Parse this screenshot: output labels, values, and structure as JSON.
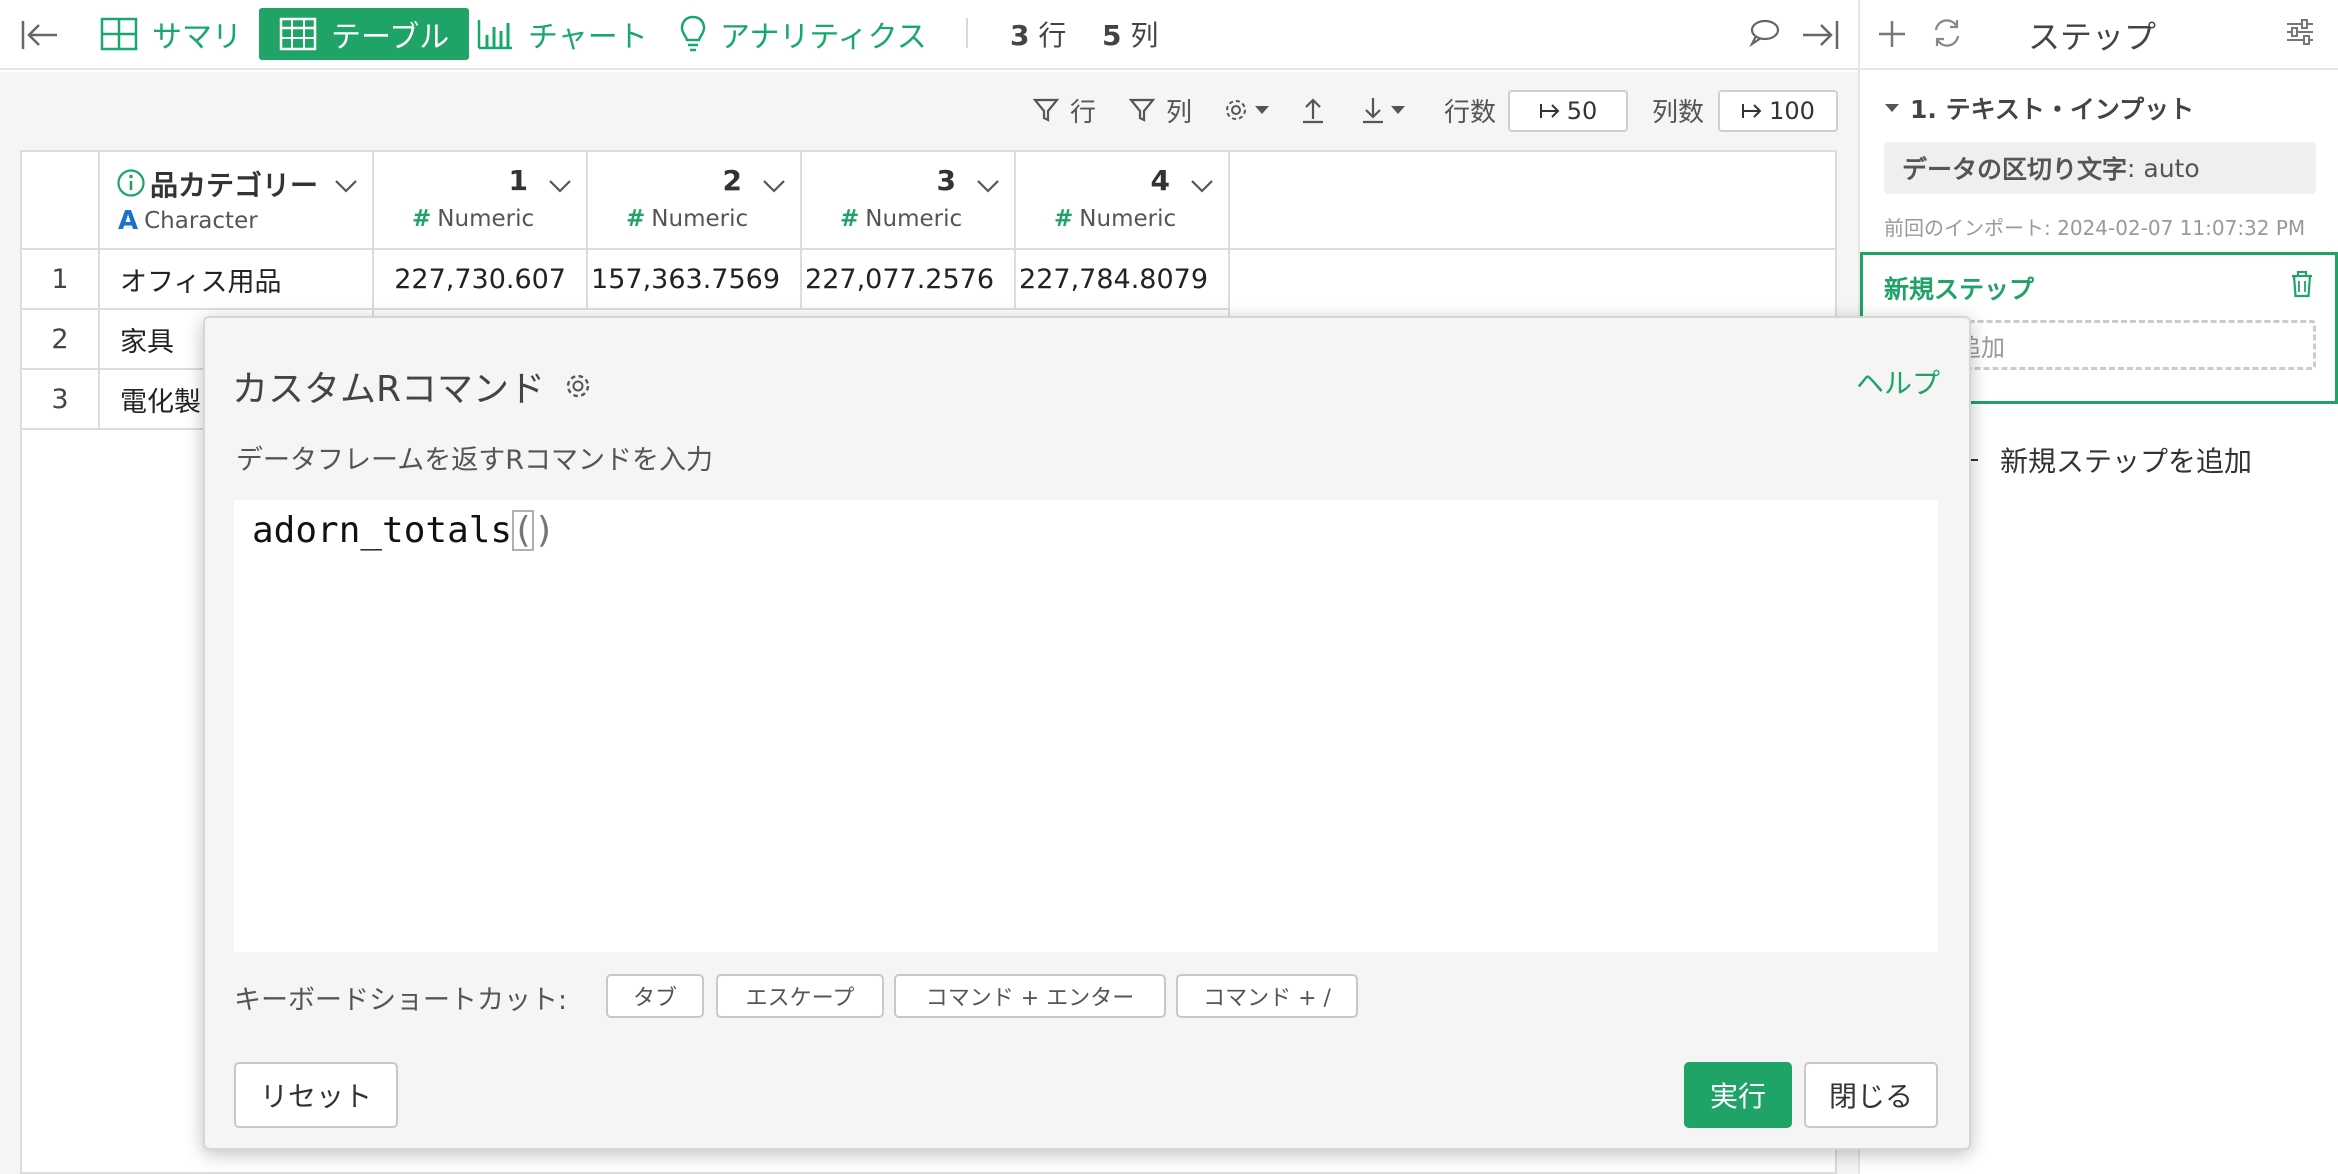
{
  "toolbar": {
    "tabs": [
      {
        "label": "サマリ",
        "icon": "summary-grid-icon"
      },
      {
        "label": "テーブル",
        "icon": "table-icon",
        "active": true
      },
      {
        "label": "チャート",
        "icon": "bar-chart-icon"
      },
      {
        "label": "アナリティクス",
        "icon": "lightbulb-icon"
      }
    ],
    "rows_count": "3",
    "rows_unit": "行",
    "cols_count": "5",
    "cols_unit": "列"
  },
  "subbar": {
    "row_filter": "行",
    "col_filter": "列",
    "rows_label": "行数",
    "rows_value": "50",
    "cols_label": "列数",
    "cols_value": "100"
  },
  "table": {
    "columns": [
      {
        "name": "品カテゴリー",
        "type": "Character"
      },
      {
        "name": "1",
        "type": "Numeric"
      },
      {
        "name": "2",
        "type": "Numeric"
      },
      {
        "name": "3",
        "type": "Numeric"
      },
      {
        "name": "4",
        "type": "Numeric"
      }
    ],
    "rows": [
      {
        "n": "1",
        "cells": [
          "オフィス用品",
          "227,730.607",
          "157,363.7569",
          "227,077.2576",
          "227,784.8079"
        ]
      },
      {
        "n": "2",
        "cells": [
          "家具"
        ]
      },
      {
        "n": "3",
        "cells": [
          "電化製"
        ]
      }
    ]
  },
  "panel": {
    "title": "ステップ",
    "step1_title": "1. テキスト・インプット",
    "step1_key": "データの区切り文字",
    "step1_value": ": auto",
    "step1_timestamp": "前回のインポート: 2024-02-07 11:07:32 PM",
    "new_step_title": "新規ステップ",
    "new_step_add": "追加",
    "add_step_label": "新規ステップを追加"
  },
  "modal": {
    "title": "カスタムRコマンド",
    "help": "ヘルプ",
    "description": "データフレームを返すRコマンドを入力",
    "code_fn": "adorn_totals",
    "code_open": "(",
    "code_close": ")",
    "shortcut_label": "キーボードショートカット:",
    "shortcuts": [
      "タブ",
      "エスケープ",
      "コマンド + エンター",
      "コマンド + /"
    ],
    "reset": "リセット",
    "run": "実行",
    "close": "閉じる"
  },
  "colors": {
    "accent": "#1fa367",
    "info_blue": "#1a73c9"
  }
}
